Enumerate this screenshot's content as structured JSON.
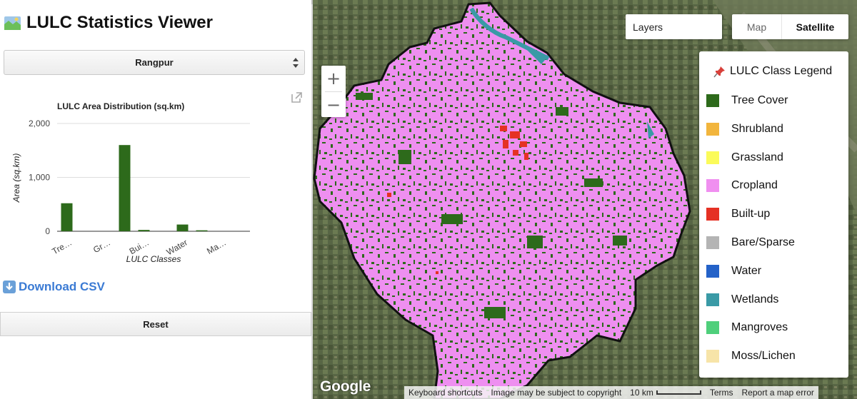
{
  "app": {
    "title": "LULC Statistics Viewer"
  },
  "region_select": {
    "value": "Rangpur"
  },
  "chart_data": {
    "type": "bar",
    "title": "LULC Area Distribution (sq.km)",
    "xlabel": "LULC Classes",
    "ylabel": "Area (sq.km)",
    "ylim": [
      0,
      2000
    ],
    "yticks": [
      "0",
      "1,000",
      "2,000"
    ],
    "categories": [
      "Tree Cover",
      "Shrubland",
      "Grassland",
      "Cropland",
      "Built-up",
      "Bare/Sparse",
      "Water",
      "Wetlands",
      "Mangroves",
      "Moss/Lichen"
    ],
    "tick_labels": [
      "Tre…",
      "Gr…",
      "Bui…",
      "Water",
      "Ma…"
    ],
    "values": [
      520,
      0,
      0,
      1600,
      25,
      0,
      125,
      18,
      0,
      0
    ],
    "color": "#2d6a1b",
    "grid": true
  },
  "download": {
    "label": "Download CSV"
  },
  "reset": {
    "label": "Reset"
  },
  "map": {
    "layers_label": "Layers",
    "maptype": {
      "map": "Map",
      "satellite": "Satellite",
      "selected": "Satellite"
    },
    "zoom_in": "+",
    "zoom_out": "−",
    "google": "Google",
    "attribution": {
      "shortcuts": "Keyboard shortcuts",
      "copyright": "Image may be subject to copyright",
      "scale": "10 km",
      "terms": "Terms",
      "report": "Report a map error"
    }
  },
  "legend": {
    "title": "LULC Class Legend",
    "items": [
      {
        "label": "Tree Cover",
        "color": "#2d6a1b"
      },
      {
        "label": "Shrubland",
        "color": "#f2b53d"
      },
      {
        "label": "Grassland",
        "color": "#fbfb5a"
      },
      {
        "label": "Cropland",
        "color": "#f08ff0"
      },
      {
        "label": "Built-up",
        "color": "#e53124"
      },
      {
        "label": "Bare/Sparse",
        "color": "#b4b4b4"
      },
      {
        "label": "Water",
        "color": "#2462c8"
      },
      {
        "label": "Wetlands",
        "color": "#3a9aa6"
      },
      {
        "label": "Mangroves",
        "color": "#4fcf7b"
      },
      {
        "label": "Moss/Lichen",
        "color": "#f7e4a8"
      }
    ]
  }
}
